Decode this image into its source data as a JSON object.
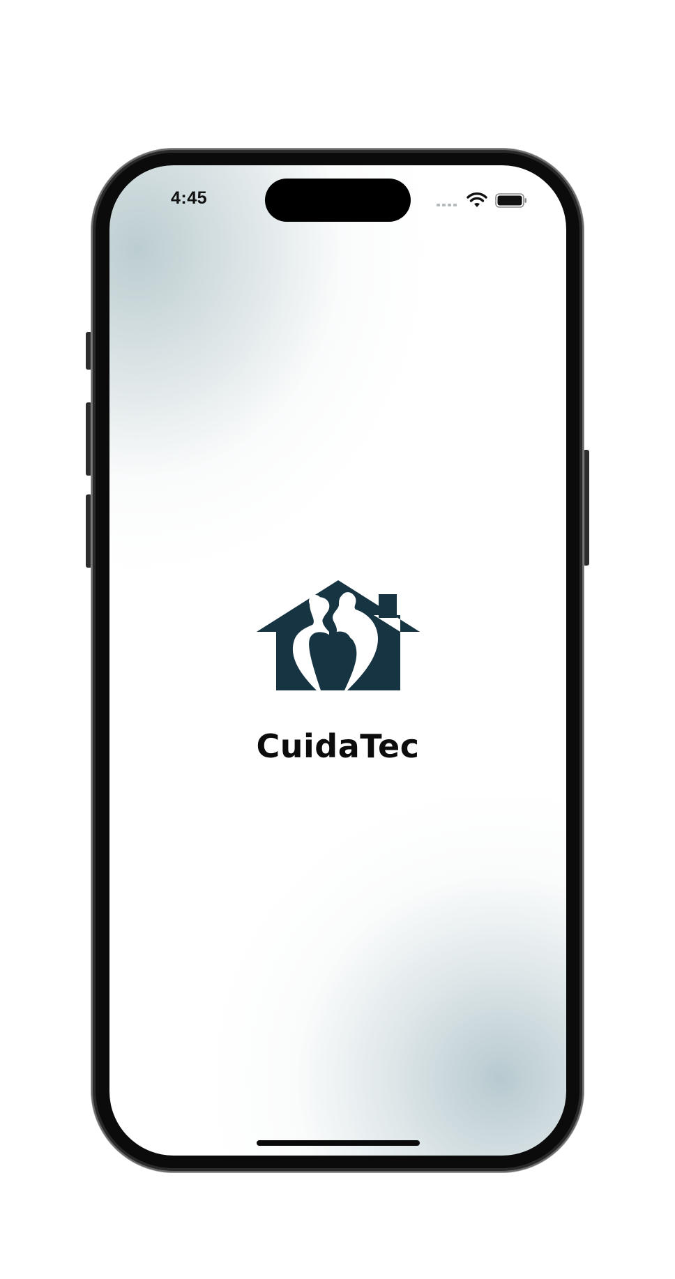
{
  "status_bar": {
    "time": "4:45",
    "wifi_icon": "wifi-icon",
    "battery_icon": "battery-icon",
    "signal_icon": "cellular-signal-dots"
  },
  "splash": {
    "app_name": "CuidaTec",
    "logo_icon": "house-with-two-people-logo"
  },
  "colors": {
    "brand": "#173442",
    "text": "#0c0c0c",
    "background_tint": "#c3d1d5"
  }
}
